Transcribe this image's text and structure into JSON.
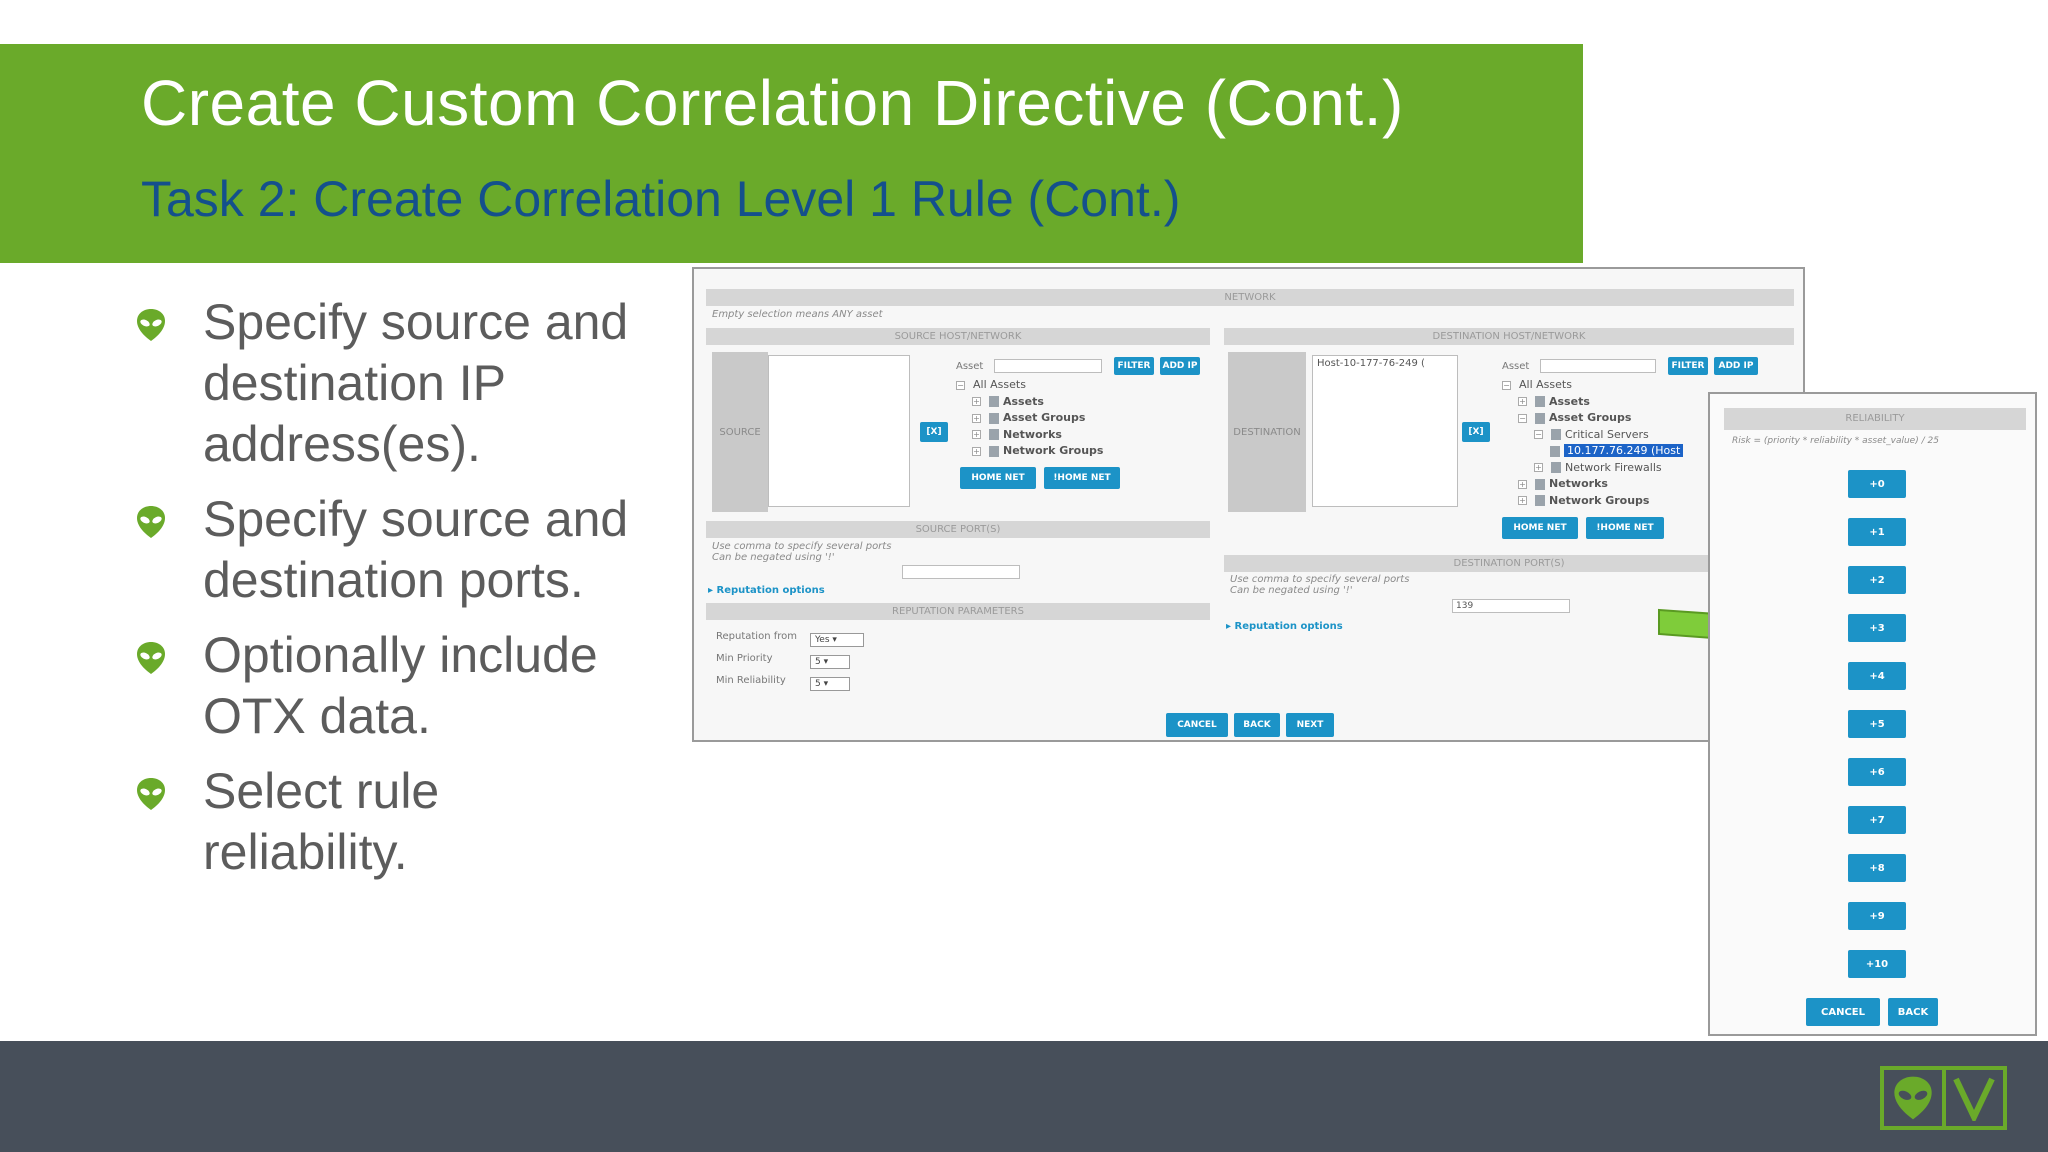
{
  "header": {
    "title": "Create Custom Correlation Directive (Cont.)",
    "subtitle": "Task 2: Create Correlation Level 1 Rule (Cont.)"
  },
  "bullets": [
    "Specify source and destination IP address(es).",
    "Specify source and destination ports.",
    "Optionally include OTX data.",
    "Select rule reliability."
  ],
  "network_panel": {
    "title": "NETWORK",
    "hint": "Empty selection means ANY asset",
    "source": {
      "section": "SOURCE HOST/NETWORK",
      "side_label": "SOURCE",
      "remove_btn": "[X]",
      "asset_label": "Asset",
      "filter_btn": "FILTER",
      "add_ip_btn": "ADD IP",
      "tree": [
        "All Assets",
        "Assets",
        "Asset Groups",
        "Networks",
        "Network Groups"
      ],
      "home_net_btn": "HOME NET",
      "not_home_net_btn": "!HOME NET"
    },
    "source_ports": {
      "section": "SOURCE PORT(S)",
      "hint1": "Use comma to specify several ports",
      "hint2": "Can be negated using '!'",
      "reputation_link": "▸ Reputation options"
    },
    "reputation": {
      "section": "REPUTATION PARAMETERS",
      "from_label": "Reputation from",
      "from_value": "Yes",
      "priority_label": "Min Priority",
      "priority_value": "5",
      "reliability_label": "Min Reliability",
      "reliability_value": "5"
    },
    "destination": {
      "section": "DESTINATION HOST/NETWORK",
      "side_label": "DESTINATION",
      "selected": "Host-10-177-76-249 (",
      "remove_btn": "[X]",
      "asset_label": "Asset",
      "filter_btn": "FILTER",
      "add_ip_btn": "ADD IP",
      "tree": [
        "All Assets",
        "Assets",
        "Asset Groups",
        "Critical Servers",
        "10.177.76.249 (Host",
        "Network Firewalls",
        "Networks",
        "Network Groups"
      ],
      "home_net_btn": "HOME NET",
      "not_home_net_btn": "!HOME NET"
    },
    "destination_ports": {
      "section": "DESTINATION PORT(S)",
      "hint1": "Use comma to specify several ports",
      "hint2": "Can be negated using '!'",
      "value": "139",
      "reputation_link": "▸ Reputation options"
    },
    "footer": {
      "cancel": "CANCEL",
      "back": "BACK",
      "next": "NEXT"
    }
  },
  "reliability_panel": {
    "title": "RELIABILITY",
    "formula": "Risk = (priority * reliability * asset_value) / 25",
    "levels": [
      "+0",
      "+1",
      "+2",
      "+3",
      "+4",
      "+5",
      "+6",
      "+7",
      "+8",
      "+9",
      "+10"
    ],
    "cancel": "CANCEL",
    "back": "BACK"
  },
  "colors": {
    "header_green": "#6aaa2a",
    "subtitle_blue": "#14508c",
    "button_blue": "#1c93c7",
    "footer_gray": "#474f5a"
  },
  "icons": {
    "bullet": "alien-head-icon",
    "arrow": "green-arrow-icon",
    "logo": "alienvault-logo"
  }
}
